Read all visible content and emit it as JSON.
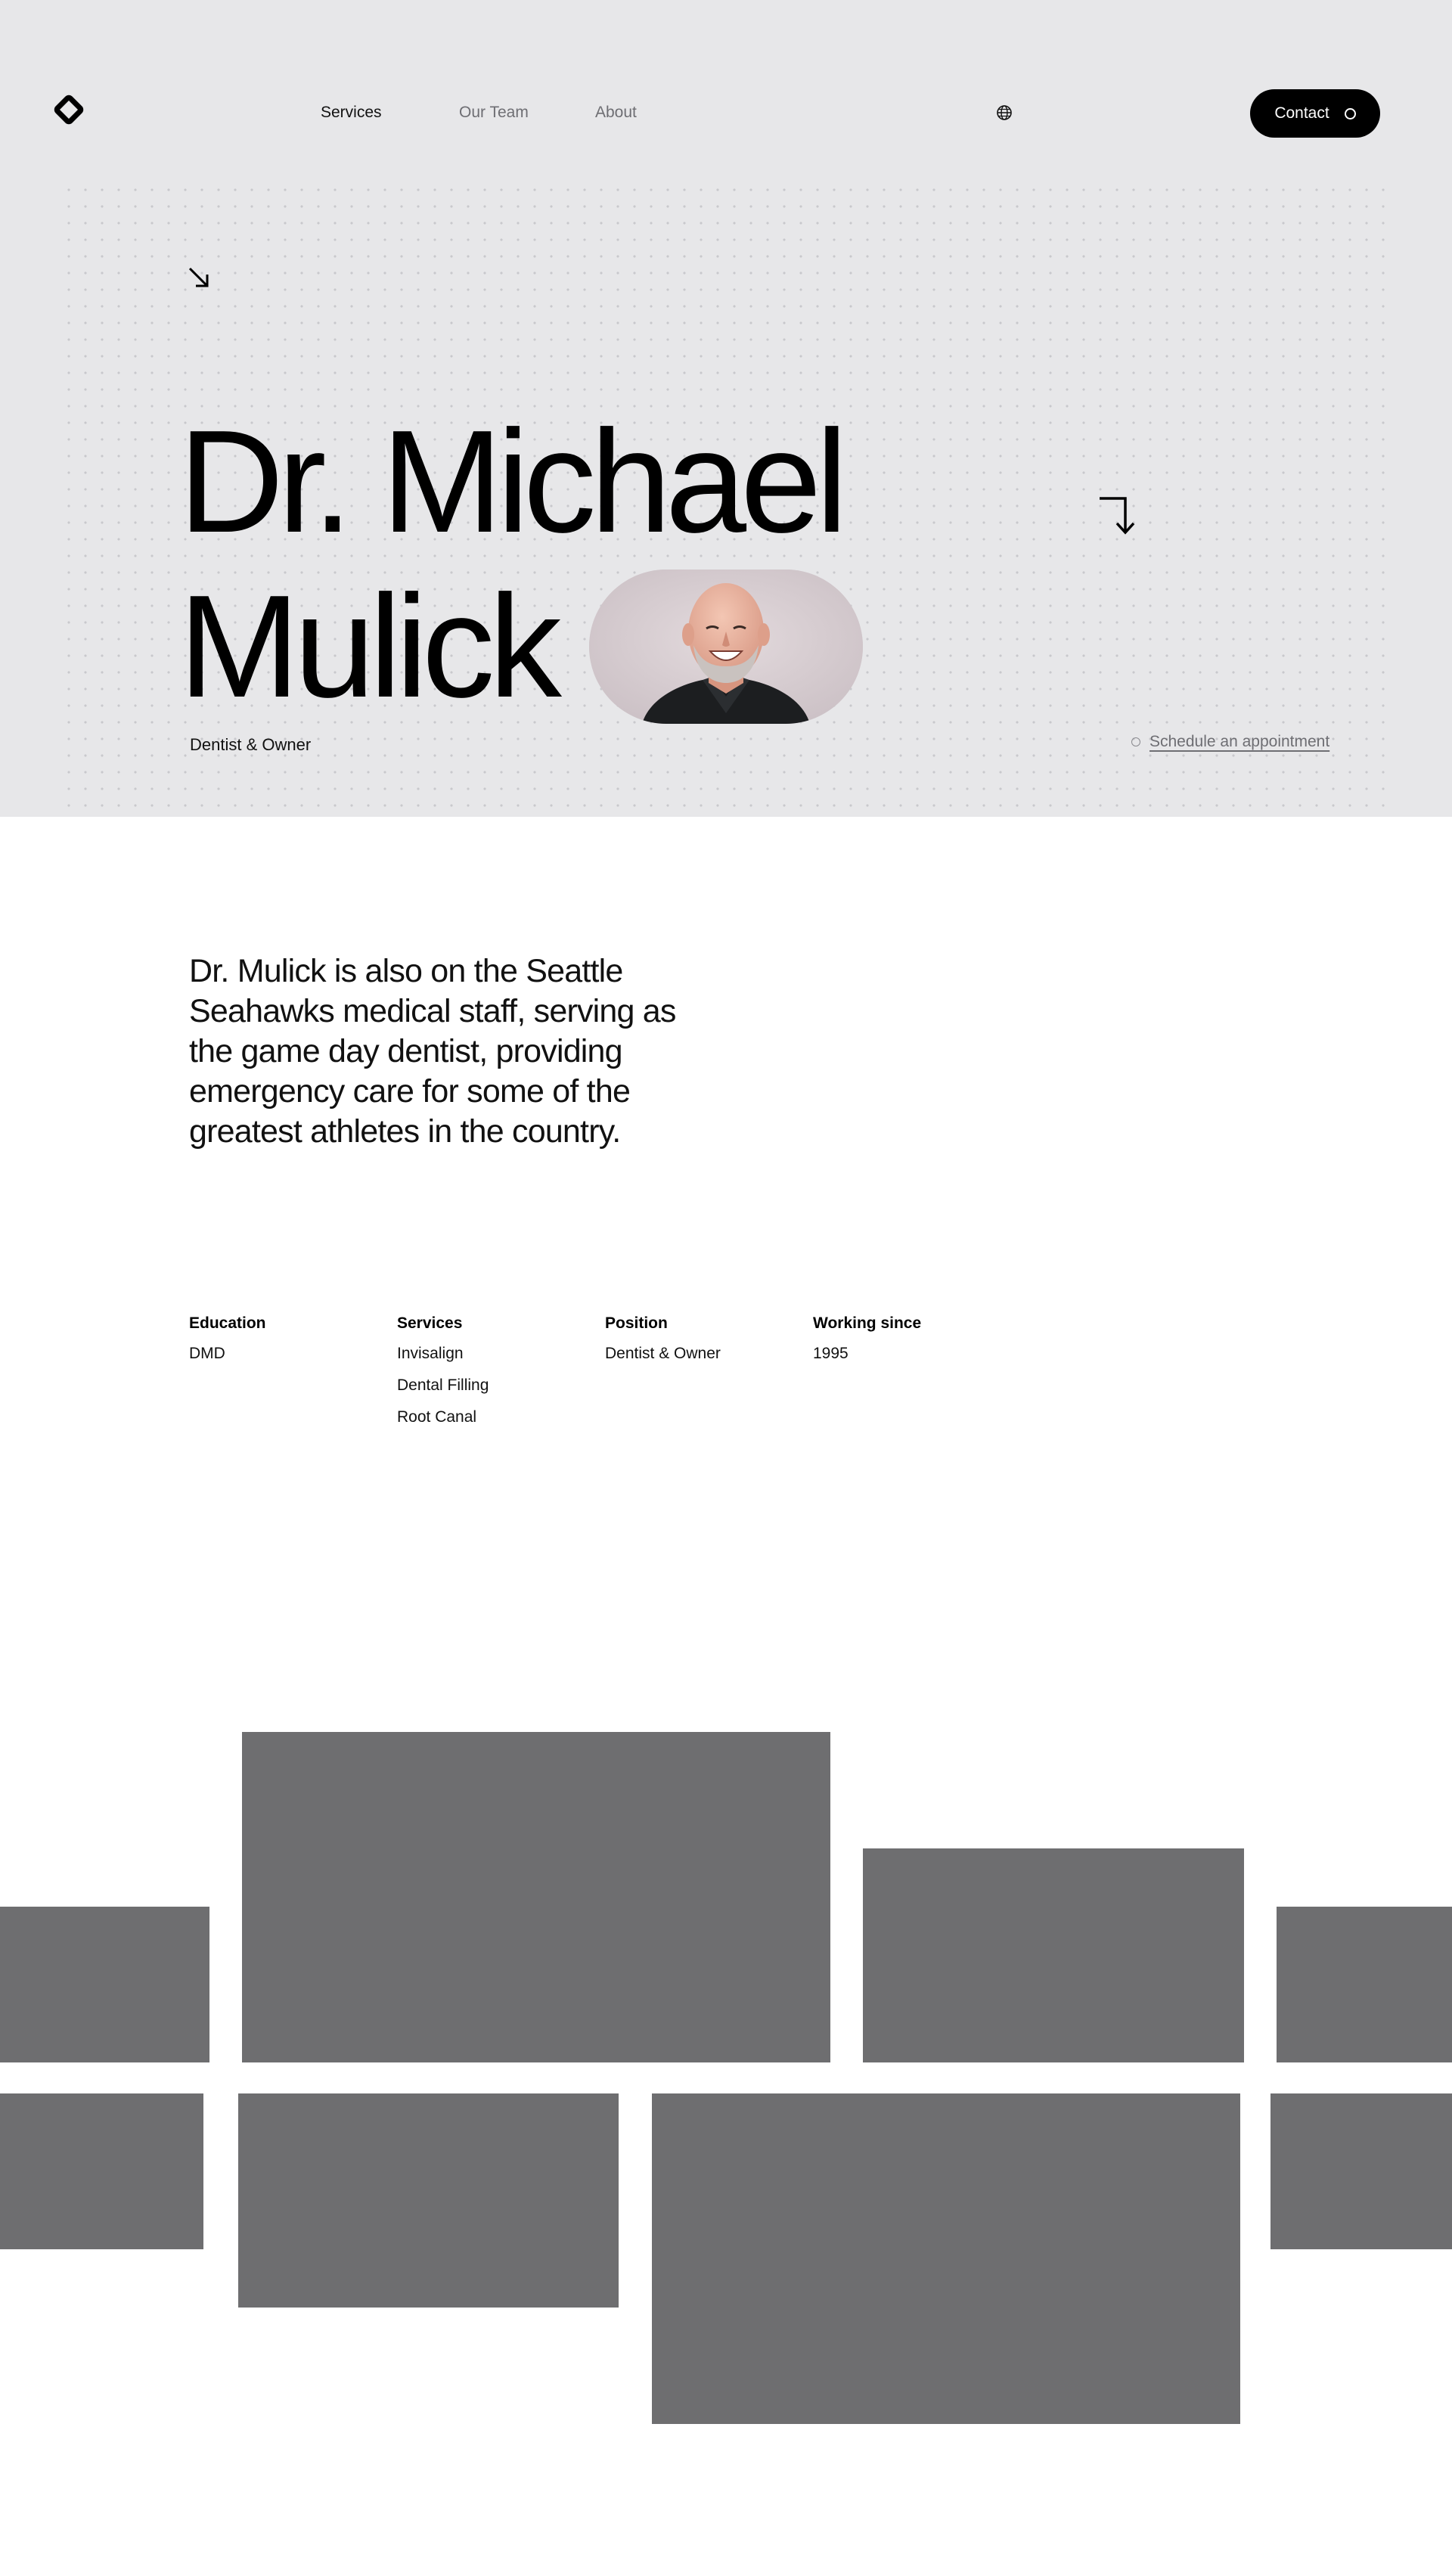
{
  "nav": {
    "links": [
      "Services",
      "Our Team",
      "About"
    ],
    "contact_label": "Contact"
  },
  "hero": {
    "name_line1": "Dr. Michael",
    "name_line2": "Mulick",
    "role": "Dentist & Owner",
    "schedule_link": "Schedule an appointment",
    "background_color": "#e7e7e9"
  },
  "bio": {
    "text": "Dr. Mulick is also on the Seattle Seahawks medical staff, serving as the game day dentist, providing emergency care for some of the greatest athletes in the country."
  },
  "details": {
    "columns": [
      {
        "heading": "Education",
        "items": [
          "DMD"
        ]
      },
      {
        "heading": "Services",
        "items": [
          "Invisalign",
          "Dental Filling",
          "Root Canal"
        ]
      },
      {
        "heading": "Position",
        "items": [
          "Dentist & Owner"
        ]
      },
      {
        "heading": "Working since",
        "items": [
          "1995"
        ]
      }
    ]
  },
  "gallery": {
    "placeholder_color": "#6e6e70",
    "tile_count": 9
  },
  "icons": [
    "logo-icon",
    "globe-icon",
    "arrow-down-right-icon",
    "arrow-turn-down-icon",
    "circle-icon"
  ]
}
